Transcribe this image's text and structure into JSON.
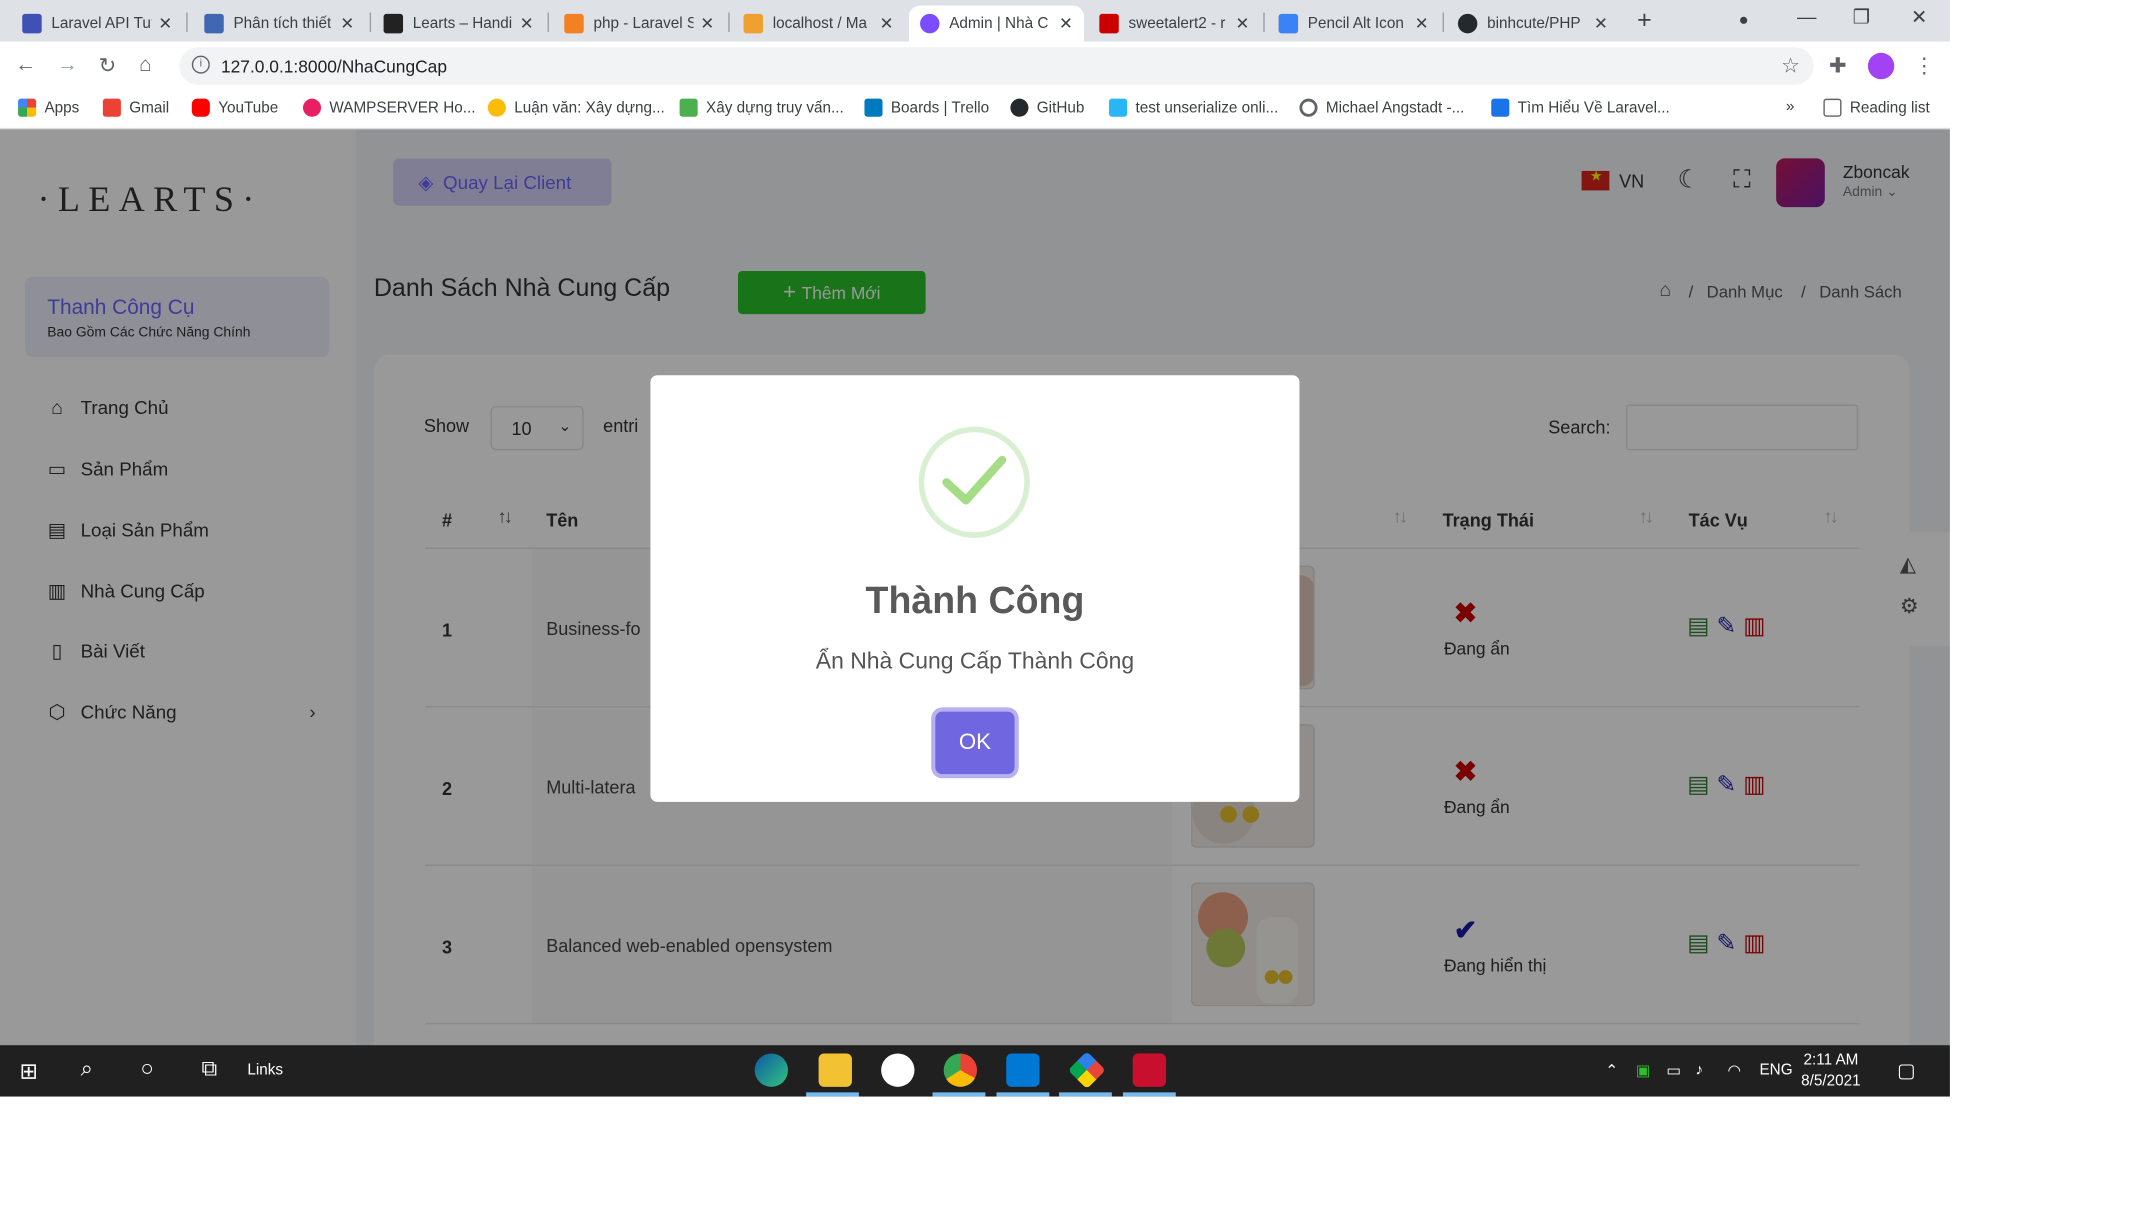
{
  "browser": {
    "tabs": [
      {
        "title": "Laravel API Tut",
        "color": "#3f51b5"
      },
      {
        "title": "Phân tích thiết",
        "color": "#4267b2"
      },
      {
        "title": "Learts – Handi",
        "color": "#222222"
      },
      {
        "title": "php - Laravel S",
        "color": "#f48024"
      },
      {
        "title": "localhost / Ma",
        "color": "#f0a030"
      },
      {
        "title": "Admin | Nhà C",
        "color": "#7c4dff"
      },
      {
        "title": "sweetalert2 - r",
        "color": "#cb0000"
      },
      {
        "title": "Pencil Alt Icon",
        "color": "#3b82f6"
      },
      {
        "title": "binhcute/PHP",
        "color": "#24292e"
      }
    ],
    "close_glyph": "✕",
    "new_tab": "+",
    "url": "127.0.0.1:8000/NhaCungCap",
    "bookmarks": [
      {
        "label": "Apps",
        "color": "#ea4335"
      },
      {
        "label": "Gmail",
        "color": "#ea4335"
      },
      {
        "label": "YouTube",
        "color": "#ff0000"
      },
      {
        "label": "WAMPSERVER Ho...",
        "color": "#e91e63"
      },
      {
        "label": "Luận văn: Xây dựng...",
        "color": "#fbbc05"
      },
      {
        "label": "Xây dựng truy vấn...",
        "color": "#4caf50"
      },
      {
        "label": "Boards | Trello",
        "color": "#0079bf"
      },
      {
        "label": "GitHub",
        "color": "#24292e"
      },
      {
        "label": "test unserialize onli...",
        "color": "#29b6f6"
      },
      {
        "label": "Michael Angstadt -...",
        "color": "#5f6368"
      },
      {
        "label": "Tìm Hiểu Về Laravel...",
        "color": "#1a73e8"
      }
    ],
    "more_bookmarks": "»",
    "reading_list": "Reading list"
  },
  "sidebar": {
    "logo": "·LEARTS·",
    "tool_title": "Thanh Công Cụ",
    "tool_sub": "Bao Gồm Các Chức Năng Chính",
    "items": [
      {
        "label": "Trang Chủ",
        "icon": "⌂"
      },
      {
        "label": "Sản Phẩm",
        "icon": "▭"
      },
      {
        "label": "Loại Sản Phẩm",
        "icon": "▤"
      },
      {
        "label": "Nhà Cung Cấp",
        "icon": "▥"
      },
      {
        "label": "Bài Viết",
        "icon": "▯"
      },
      {
        "label": "Chức Năng",
        "icon": "⬡"
      }
    ],
    "chevron": "›"
  },
  "header": {
    "back_client": "Quay Lại Client",
    "lang": "VN",
    "user_name": "Zboncak",
    "user_role": "Admin ⌄"
  },
  "content": {
    "title": "Danh Sách Nhà Cung Cấp",
    "add_button": "Thêm Mới",
    "breadcrumb_1": "Danh Mục",
    "breadcrumb_sep": "/",
    "breadcrumb_2": "Danh Sách",
    "show_label": "Show",
    "page_size": "10",
    "entries_label": "entri",
    "search_label": "Search:",
    "columns": {
      "idx": "#",
      "name": "Tên",
      "status": "Trạng Thái",
      "action": "Tác Vụ"
    },
    "rows": [
      {
        "idx": "1",
        "name": "Business-fo",
        "status_icon": "✖",
        "status_color": "#cc0000",
        "status": "Đang ẩn"
      },
      {
        "idx": "2",
        "name": "Multi-latera",
        "status_icon": "✖",
        "status_color": "#cc0000",
        "status": "Đang ẩn"
      },
      {
        "idx": "3",
        "name": "Balanced web-enabled opensystem",
        "status_icon": "✔",
        "status_color": "#1a1aa6",
        "status": "Đang hiển thị"
      }
    ]
  },
  "modal": {
    "title": "Thành Công",
    "text": "Ẩn Nhà Cung Cấp Thành Công",
    "ok": "OK"
  },
  "taskbar": {
    "search_links": "Links",
    "lang": "ENG",
    "time": "2:11 AM",
    "date": "8/5/2021"
  }
}
